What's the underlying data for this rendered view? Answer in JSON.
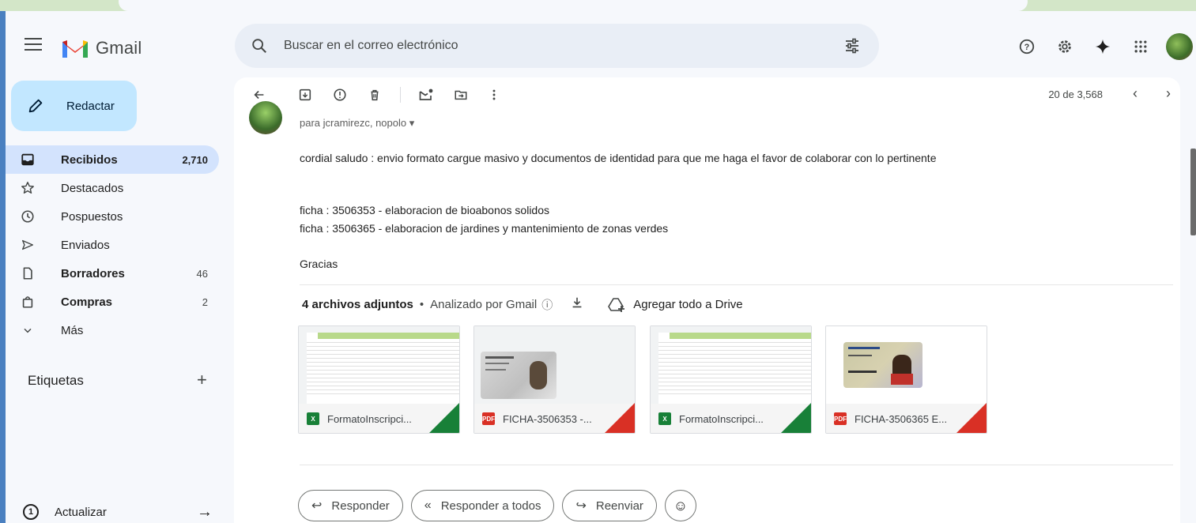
{
  "app": {
    "name": "Gmail",
    "search_placeholder": "Buscar en el correo electrónico"
  },
  "header_icons": [
    "help-icon",
    "settings-icon",
    "gemini-icon",
    "apps-icon",
    "account-avatar"
  ],
  "compose": {
    "label": "Redactar"
  },
  "nav": [
    {
      "label": "Recibidos",
      "count": "2,710",
      "icon": "inbox-icon",
      "active": true
    },
    {
      "label": "Destacados",
      "count": "",
      "icon": "star-icon"
    },
    {
      "label": "Pospuestos",
      "count": "",
      "icon": "clock-icon"
    },
    {
      "label": "Enviados",
      "count": "",
      "icon": "send-icon"
    },
    {
      "label": "Borradores",
      "count": "46",
      "icon": "draft-icon",
      "bold": true
    },
    {
      "label": "Compras",
      "count": "2",
      "icon": "shopping-bag-icon",
      "bold": true
    },
    {
      "label": "Más",
      "count": "",
      "icon": "chevron-down-icon"
    }
  ],
  "labels": {
    "heading": "Etiquetas",
    "add": "+"
  },
  "update": {
    "number": "1",
    "label": "Actualizar"
  },
  "toolbar": {
    "pager": "20 de 3,568"
  },
  "message": {
    "recipients": "para jcramirezc, nopolo ▾",
    "body": [
      "cordial saludo : envio formato cargue masivo y documentos de identidad para que me haga el favor de colaborar con lo pertinente",
      "ficha : 3506353 - elaboracion de bioabonos solidos",
      "ficha :  3506365 - elaboracion de jardines y mantenimiento de zonas verdes",
      "Gracias"
    ]
  },
  "attachments": {
    "count_label": "4 archivos adjuntos",
    "separator": "•",
    "scanned": "Analizado por Gmail",
    "drive_label": "Agregar todo a Drive",
    "files": [
      {
        "name": "FormatoInscripci...",
        "type": "xlsx",
        "color": "#188038"
      },
      {
        "name": "FICHA-3506353 -...",
        "type": "pdf",
        "color": "#d93025"
      },
      {
        "name": "FormatoInscripci...",
        "type": "xlsx",
        "color": "#188038"
      },
      {
        "name": "FICHA-3506365 E...",
        "type": "pdf",
        "color": "#d93025"
      }
    ]
  },
  "reply": {
    "reply": "Responder",
    "reply_all": "Responder a todos",
    "forward": "Reenviar"
  }
}
